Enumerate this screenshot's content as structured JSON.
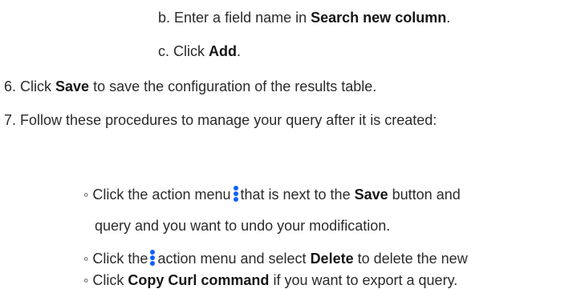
{
  "steps": [
    {
      "marker": "b.",
      "parts": [
        "Enter a field name in ",
        "Search new column",
        "."
      ]
    },
    {
      "marker": "c.",
      "parts": [
        "Click ",
        "Add",
        "."
      ]
    },
    {
      "marker": "6.",
      "parts": [
        "Click ",
        "Save",
        " to save the configuration of the results table."
      ]
    },
    {
      "marker": "7.",
      "parts": [
        "Follow these procedures to manage your query after it is created:"
      ]
    }
  ],
  "bullets": [
    {
      "marker": "◦",
      "line1": [
        "Click the action menu",
        "that is next to the ",
        "Save",
        " button and"
      ],
      "line2": "query and you want to undo your modification."
    },
    {
      "marker": "◦",
      "parts": [
        "Click the",
        "action menu and select ",
        "Delete",
        " to delete the new"
      ]
    },
    {
      "marker": "◦",
      "parts": [
        "Click ",
        "Copy Curl command",
        " if you want to export a query."
      ]
    }
  ],
  "icons": {
    "action_menu": "overflow-menu-vertical-icon",
    "accent_color": "#0f62fe"
  }
}
